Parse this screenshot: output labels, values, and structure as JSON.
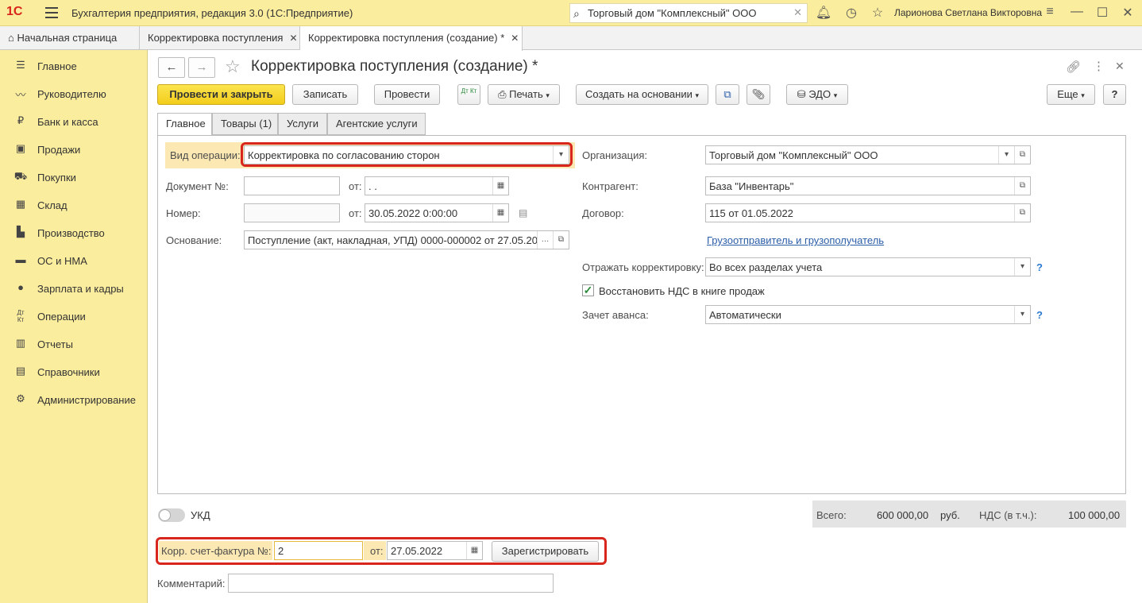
{
  "app": {
    "logo": "1С",
    "title": "Бухгалтерия предприятия, редакция 3.0  (1С:Предприятие)",
    "search_value": "Торговый дом \"Комплексный\" ООО",
    "user": "Ларионова Светлана Викторовна"
  },
  "tabs": [
    {
      "label": "Начальная страница"
    },
    {
      "label": "Корректировка поступления"
    },
    {
      "label": "Корректировка поступления (создание) *"
    }
  ],
  "sidebar": {
    "items": [
      {
        "label": "Главное",
        "icon": "menu-icon"
      },
      {
        "label": "Руководителю",
        "icon": "trend-icon"
      },
      {
        "label": "Банк и касса",
        "icon": "ruble-icon"
      },
      {
        "label": "Продажи",
        "icon": "bag-icon"
      },
      {
        "label": "Покупки",
        "icon": "cart-icon"
      },
      {
        "label": "Склад",
        "icon": "warehouse-icon"
      },
      {
        "label": "Производство",
        "icon": "factory-icon"
      },
      {
        "label": "ОС и НМА",
        "icon": "truck-icon"
      },
      {
        "label": "Зарплата и кадры",
        "icon": "person-icon"
      },
      {
        "label": "Операции",
        "icon": "dtkt-icon"
      },
      {
        "label": "Отчеты",
        "icon": "chart-icon"
      },
      {
        "label": "Справочники",
        "icon": "book-icon"
      },
      {
        "label": "Администрирование",
        "icon": "gear-icon"
      }
    ]
  },
  "form": {
    "title": "Корректировка поступления (создание) *",
    "toolbar": {
      "post_close": "Провести и закрыть",
      "save": "Записать",
      "post": "Провести",
      "dtkt": "Дт Кт",
      "print": "Печать",
      "create_based": "Создать на основании",
      "edo": "ЭДО",
      "more": "Еще",
      "help": "?"
    },
    "tabs": [
      "Главное",
      "Товары (1)",
      "Услуги",
      "Агентские услуги"
    ],
    "left": {
      "op_type_label": "Вид операции:",
      "op_type_value": "Корректировка по согласованию сторон",
      "doc_no_label": "Документ №:",
      "doc_no_value": "",
      "ot_label": "от:",
      "doc_date_value": " .  .",
      "number_label": "Номер:",
      "number_value": "",
      "number_date_value": "30.05.2022  0:00:00",
      "basis_label": "Основание:",
      "basis_value": "Поступление (акт, накладная, УПД) 0000-000002 от 27.05.20"
    },
    "right": {
      "org_label": "Организация:",
      "org_value": "Торговый дом \"Комплексный\" ООО",
      "counterparty_label": "Контрагент:",
      "counterparty_value": "База \"Инвентарь\"",
      "contract_label": "Договор:",
      "contract_value": "115 от 01.05.2022",
      "shipper_link": "Грузоотправитель и грузополучатель",
      "reflect_label": "Отражать корректировку:",
      "reflect_value": "Во всех разделах учета",
      "vat_restore_label": "Восстановить НДС в книге продаж",
      "vat_restore_checked": true,
      "advance_label": "Зачет аванса:",
      "advance_value": "Автоматически"
    },
    "footer": {
      "ukd_label": "УКД",
      "ukd_on": false,
      "total_label": "Всего:",
      "total_value": "600 000,00",
      "currency": "руб.",
      "vat_label": "НДС (в т.ч.):",
      "vat_value": "100 000,00",
      "invoice_label": "Корр. счет-фактура №:",
      "invoice_no": "2",
      "invoice_ot": "от:",
      "invoice_date": "27.05.2022",
      "register_btn": "Зарегистрировать",
      "comment_label": "Комментарий:",
      "comment_value": ""
    }
  },
  "colors": {
    "highlight": "#d9261c",
    "accent_yellow": "#fbed9e",
    "primary_btn": "#f3cd1b",
    "link": "#2b5ea8"
  }
}
